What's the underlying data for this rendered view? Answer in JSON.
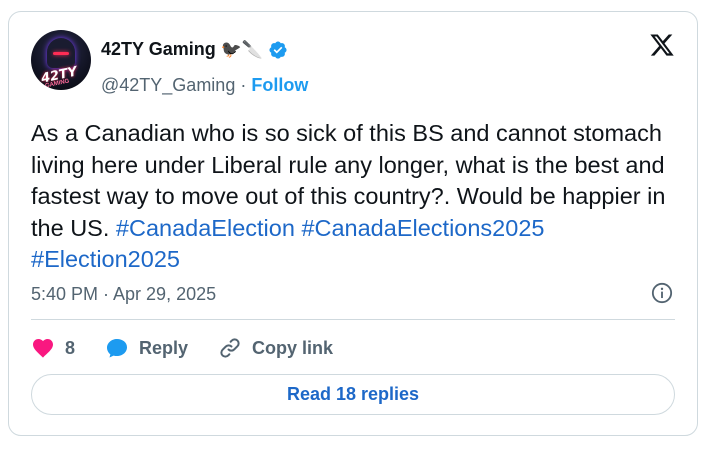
{
  "author": {
    "name": "42TY Gaming",
    "name_emojis": "🐦‍⬛🔪",
    "handle": "@42TY_Gaming",
    "separator": "·",
    "follow_label": "Follow",
    "avatar_text": "42TY",
    "avatar_subtext": "GAMING"
  },
  "tweet": {
    "text": "As a Canadian who is so sick of this BS and cannot stomach living here under Liberal rule any longer, what is the best and fastest way to move out of this country?. Would be happier in the US. ",
    "hashtags": [
      "#CanadaElection",
      "#CanadaElections2025",
      "#Election2025"
    ],
    "timestamp": "5:40 PM · Apr 29, 2025"
  },
  "actions": {
    "like_count": "8",
    "reply_label": "Reply",
    "copy_link_label": "Copy link"
  },
  "read_replies_label": "Read 18 replies",
  "colors": {
    "accent": "#1d9bf0",
    "link": "#1d68c8",
    "heart": "#f91880",
    "muted": "#536471",
    "border": "#cfd9de"
  },
  "icons": {
    "platform": "x-logo-icon",
    "verified": "verified-badge-icon",
    "info": "info-icon",
    "like": "heart-icon",
    "reply": "speech-bubble-icon",
    "copy_link": "link-icon"
  }
}
